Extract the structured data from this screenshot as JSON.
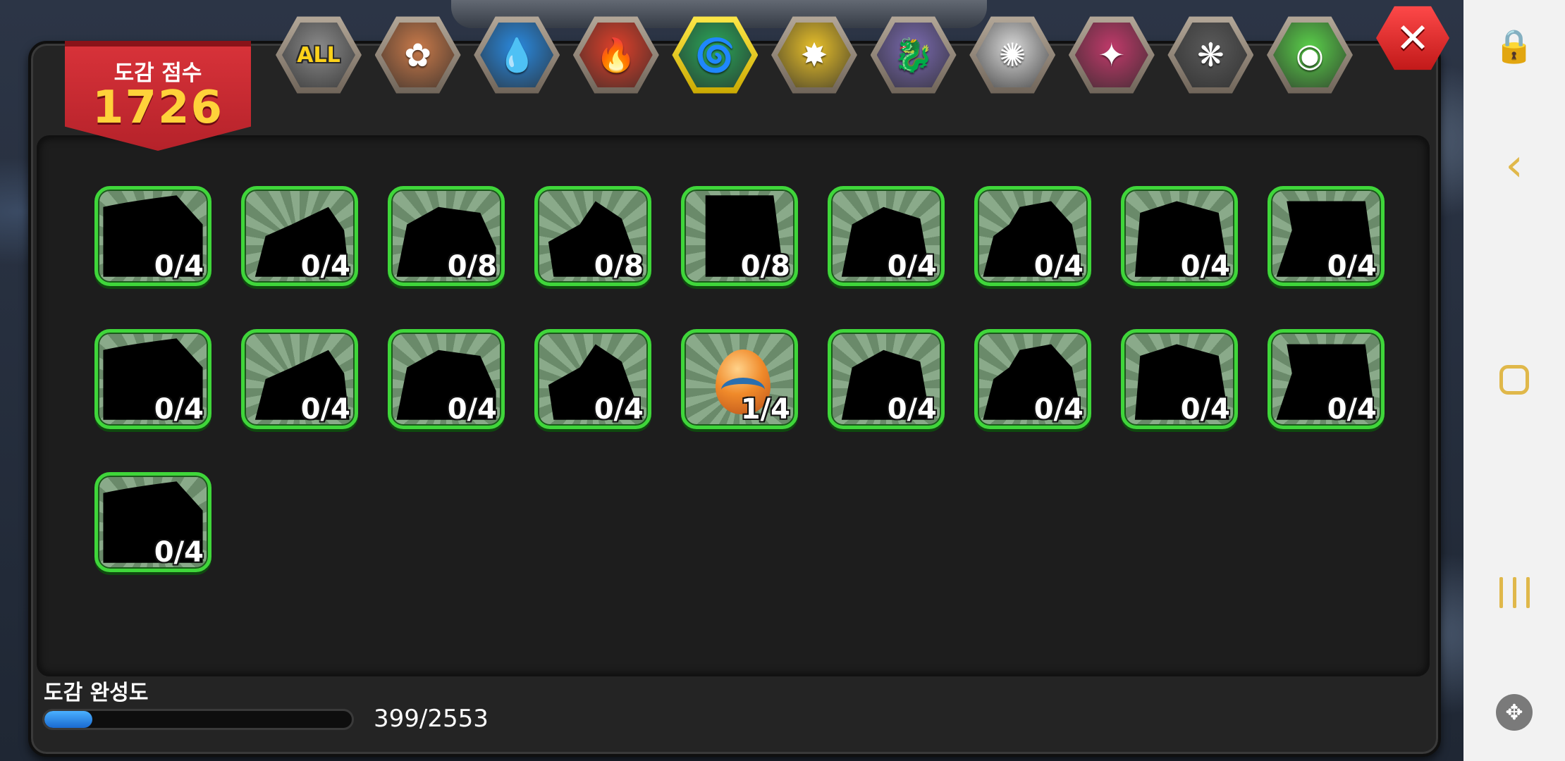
{
  "score": {
    "label": "도감 점수",
    "value": "1726"
  },
  "tabs": [
    {
      "id": "all",
      "text": "ALL",
      "icon": "all-icon",
      "color": "#8a8a8a"
    },
    {
      "id": "earth",
      "icon": "earth-element-icon",
      "glyph": "✿",
      "color": "#c97a4a"
    },
    {
      "id": "water",
      "icon": "water-element-icon",
      "glyph": "💧",
      "color": "#2a8ae0"
    },
    {
      "id": "fire",
      "icon": "fire-element-icon",
      "glyph": "🔥",
      "color": "#e0402a"
    },
    {
      "id": "wind",
      "icon": "wind-element-icon",
      "glyph": "🌀",
      "color": "#2aa85a",
      "active": true
    },
    {
      "id": "light",
      "icon": "light-element-icon",
      "glyph": "✸",
      "color": "#e8c02a"
    },
    {
      "id": "dragon",
      "icon": "dragon-element-icon",
      "glyph": "🐉",
      "color": "#7a6ab0"
    },
    {
      "id": "wind2",
      "icon": "swirl-element-icon",
      "glyph": "✺",
      "color": "#d8d8d8"
    },
    {
      "id": "demon",
      "icon": "demon-element-icon",
      "glyph": "✦",
      "color": "#c03a6a"
    },
    {
      "id": "dark",
      "icon": "dark-element-icon",
      "glyph": "❋",
      "color": "#5a5a5a"
    },
    {
      "id": "rainbow",
      "icon": "rainbow-element-icon",
      "glyph": "◉",
      "color": "#5ad04a"
    }
  ],
  "collection": [
    {
      "count": "0/4"
    },
    {
      "count": "0/4"
    },
    {
      "count": "0/8"
    },
    {
      "count": "0/8"
    },
    {
      "count": "0/8"
    },
    {
      "count": "0/4"
    },
    {
      "count": "0/4"
    },
    {
      "count": "0/4"
    },
    {
      "count": "0/4"
    },
    {
      "count": "0/4"
    },
    {
      "count": "0/4"
    },
    {
      "count": "0/4"
    },
    {
      "count": "0/4"
    },
    {
      "count": "1/4",
      "egg": true
    },
    {
      "count": "0/4"
    },
    {
      "count": "0/4"
    },
    {
      "count": "0/4"
    },
    {
      "count": "0/4"
    },
    {
      "count": "0/4"
    }
  ],
  "completion": {
    "label": "도감 완성도",
    "count": "399/2553",
    "fraction": 0.156
  },
  "colors": {
    "accent": "#3fd63a",
    "score": "#ffd23a",
    "banner": "#d9333a"
  },
  "navbar": {
    "icons": [
      "lock-touch-icon",
      "back-icon",
      "home-icon",
      "recents-icon",
      "game-tools-icon"
    ]
  }
}
